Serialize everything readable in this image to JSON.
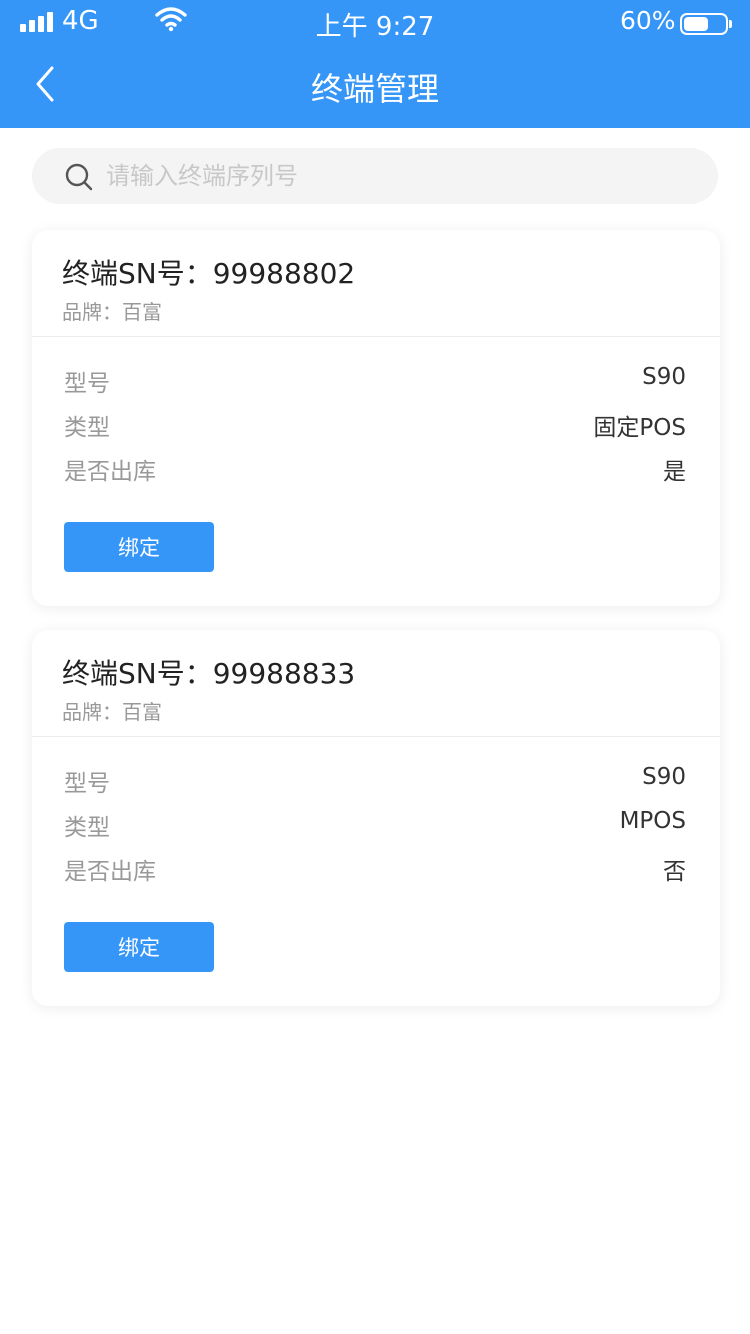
{
  "status_bar": {
    "network": "4G",
    "time": "上午 9:27",
    "battery_percent": "60%",
    "battery_level": 0.6
  },
  "nav": {
    "title": "终端管理",
    "back_icon": "chevron-left-icon"
  },
  "search": {
    "placeholder": "请输入终端序列号",
    "value": "",
    "icon": "search-icon"
  },
  "colors": {
    "primary": "#3596f8"
  },
  "terminals": [
    {
      "sn": "终端SN号：99988802",
      "brand": "品牌：百富",
      "rows": [
        {
          "label": "型号",
          "value": "S90"
        },
        {
          "label": "类型",
          "value": "固定POS"
        },
        {
          "label": "是否出库",
          "value": "是"
        }
      ],
      "action": "绑定"
    },
    {
      "sn": "终端SN号：99988833",
      "brand": "品牌：百富",
      "rows": [
        {
          "label": "型号",
          "value": "S90"
        },
        {
          "label": "类型",
          "value": "MPOS"
        },
        {
          "label": "是否出库",
          "value": "否"
        }
      ],
      "action": "绑定"
    }
  ]
}
